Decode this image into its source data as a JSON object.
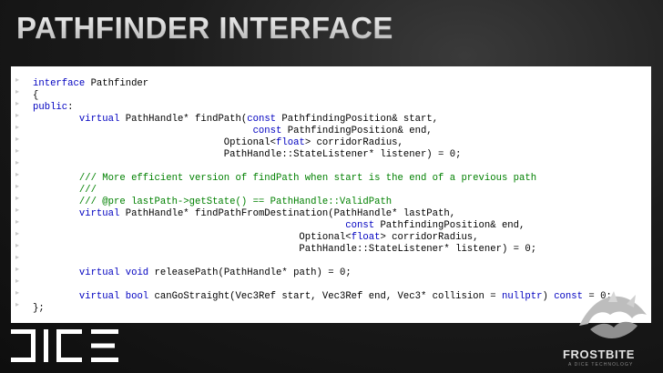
{
  "slide": {
    "title": "PATHFINDER INTERFACE"
  },
  "code": {
    "lines": [
      [
        {
          "t": "interface",
          "c": "kw"
        },
        {
          "t": " Pathfinder"
        }
      ],
      [
        {
          "t": "{"
        }
      ],
      [
        {
          "t": "public",
          "c": "kw"
        },
        {
          "t": ":"
        }
      ],
      [
        {
          "t": "        "
        },
        {
          "t": "virtual",
          "c": "kw"
        },
        {
          "t": " PathHandle* findPath("
        },
        {
          "t": "const",
          "c": "kw"
        },
        {
          "t": " PathfindingPosition& start,"
        }
      ],
      [
        {
          "t": "                                      "
        },
        {
          "t": "const",
          "c": "kw"
        },
        {
          "t": " PathfindingPosition& end,"
        }
      ],
      [
        {
          "t": "                                 Optional<"
        },
        {
          "t": "float",
          "c": "kw"
        },
        {
          "t": "> corridorRadius,"
        }
      ],
      [
        {
          "t": "                                 PathHandle::StateListener* listener) = 0;"
        }
      ],
      [
        {
          "t": ""
        }
      ],
      [
        {
          "t": "        "
        },
        {
          "t": "/// More efficient version of findPath when start is the end of a previous path",
          "c": "cm"
        }
      ],
      [
        {
          "t": "        "
        },
        {
          "t": "///",
          "c": "cm"
        }
      ],
      [
        {
          "t": "        "
        },
        {
          "t": "/// @pre lastPath->getState() == PathHandle::ValidPath",
          "c": "cm"
        }
      ],
      [
        {
          "t": "        "
        },
        {
          "t": "virtual",
          "c": "kw"
        },
        {
          "t": " PathHandle* findPathFromDestination(PathHandle* lastPath,"
        }
      ],
      [
        {
          "t": "                                                      "
        },
        {
          "t": "const",
          "c": "kw"
        },
        {
          "t": " PathfindingPosition& end,"
        }
      ],
      [
        {
          "t": "                                              Optional<"
        },
        {
          "t": "float",
          "c": "kw"
        },
        {
          "t": "> corridorRadius,"
        }
      ],
      [
        {
          "t": "                                              PathHandle::StateListener* listener) = 0;"
        }
      ],
      [
        {
          "t": ""
        }
      ],
      [
        {
          "t": "        "
        },
        {
          "t": "virtual",
          "c": "kw"
        },
        {
          "t": " "
        },
        {
          "t": "void",
          "c": "kw"
        },
        {
          "t": " releasePath(PathHandle* path) = 0;"
        }
      ],
      [
        {
          "t": ""
        }
      ],
      [
        {
          "t": "        "
        },
        {
          "t": "virtual",
          "c": "kw"
        },
        {
          "t": " "
        },
        {
          "t": "bool",
          "c": "kw"
        },
        {
          "t": " canGoStraight(Vec3Ref start, Vec3Ref end, Vec3* collision = "
        },
        {
          "t": "nullptr",
          "c": "kw"
        },
        {
          "t": ") "
        },
        {
          "t": "const",
          "c": "kw"
        },
        {
          "t": " = 0;"
        }
      ],
      [
        {
          "t": "};"
        }
      ]
    ],
    "gutter_marker": "▸",
    "colors": {
      "keyword": "#0000c0",
      "comment": "#008000",
      "text": "#000000"
    }
  },
  "footer": {
    "left_logo": "DICE",
    "right_logo_name": "FROSTBITE",
    "right_logo_sub": "A DICE TECHNOLOGY"
  }
}
